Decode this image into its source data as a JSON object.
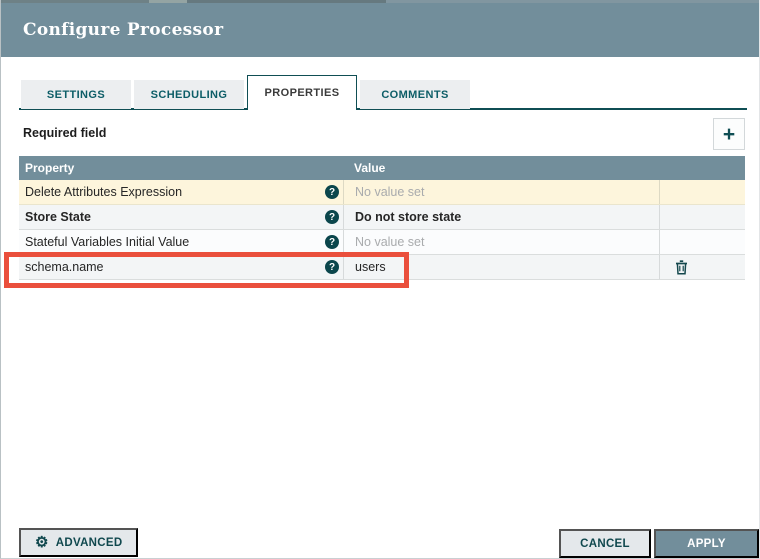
{
  "window": {
    "title": "Configure Processor"
  },
  "tabs": [
    {
      "label": "SETTINGS",
      "active": false
    },
    {
      "label": "SCHEDULING",
      "active": false
    },
    {
      "label": "PROPERTIES",
      "active": true
    },
    {
      "label": "COMMENTS",
      "active": false
    }
  ],
  "properties_panel": {
    "required_field_label": "Required field",
    "columns": {
      "property": "Property",
      "value": "Value"
    },
    "rows": [
      {
        "property": "Delete Attributes Expression",
        "value": "No value set",
        "value_set": false,
        "required_unset": true,
        "deletable": false
      },
      {
        "property": "Store State",
        "value": "Do not store state",
        "value_set": true,
        "emphasis": true,
        "deletable": false
      },
      {
        "property": "Stateful Variables Initial Value",
        "value": "No value set",
        "value_set": false,
        "deletable": false
      },
      {
        "property": "schema.name",
        "value": "users",
        "value_set": true,
        "deletable": true,
        "annotated": true
      }
    ]
  },
  "footer": {
    "advanced_label": "ADVANCED",
    "cancel_label": "CANCEL",
    "apply_label": "APPLY"
  },
  "icons": {
    "plus": "+",
    "help": "?",
    "gear": "⚙"
  },
  "colors": {
    "slate": "#728e9b",
    "teal": "#0c5d67",
    "teal-dark": "#0f4e54",
    "annotation-red": "#ea4f3c",
    "required-row": "#fdf5dc"
  }
}
